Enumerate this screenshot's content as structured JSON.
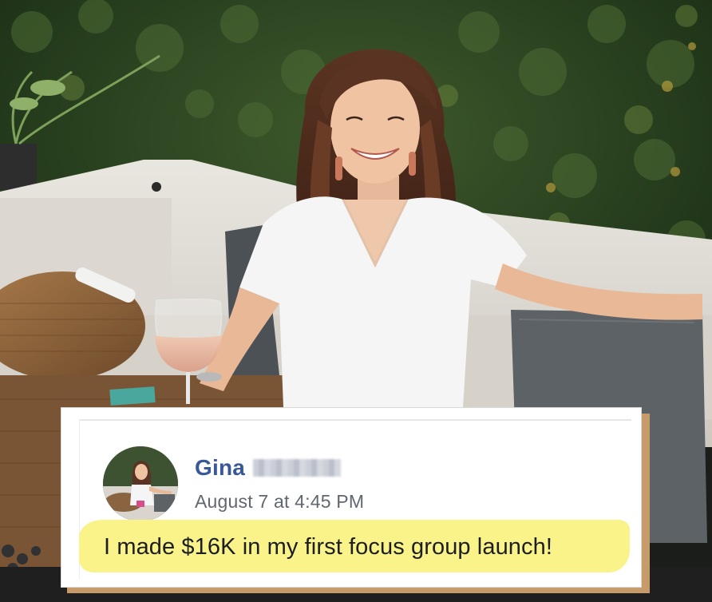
{
  "post": {
    "author_name": "Gina",
    "timestamp": "August 7 at 4:45 PM",
    "text": "I made $16K in my first focus group launch!"
  },
  "colors": {
    "author_link": "#385898",
    "timestamp": "#616770",
    "highlight": "#f9f38a",
    "card_shadow": "#c79a6a",
    "body_text": "#1c1e21"
  },
  "icons": {
    "avatar": "profile-photo"
  }
}
